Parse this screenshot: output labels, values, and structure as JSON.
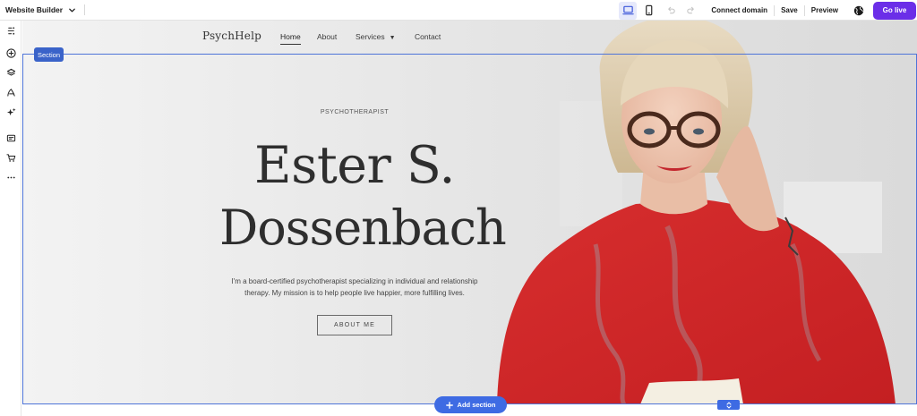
{
  "toolbar": {
    "site_switcher_label": "Website Builder",
    "connect_domain_label": "Connect domain",
    "save_label": "Save",
    "preview_label": "Preview",
    "go_live_label": "Go live",
    "active_device": "desktop",
    "accent_color": "#6b2ee8"
  },
  "left_rail": {
    "tools": [
      "page-structure-icon",
      "add-element-icon",
      "layers-icon",
      "design-icon",
      "ai-assistant-icon",
      "blog-icon",
      "store-icon",
      "more-icon"
    ]
  },
  "editor": {
    "section_tag_label": "Section",
    "add_section_label": "Add section",
    "selection_color": "#3e6be3"
  },
  "site": {
    "logo": "PsychHelp",
    "nav": {
      "home": "Home",
      "about": "About",
      "services": "Services",
      "contact": "Contact"
    },
    "hero": {
      "eyebrow": "PSYCHOTHERAPIST",
      "name_line1": "Ester S.",
      "name_line2": "Dossenbach",
      "description": "I'm a board-certified psychotherapist specializing in individual and relationship therapy. My mission is to help people live happier, more fulfilling lives.",
      "cta_label": "ABOUT ME"
    }
  }
}
